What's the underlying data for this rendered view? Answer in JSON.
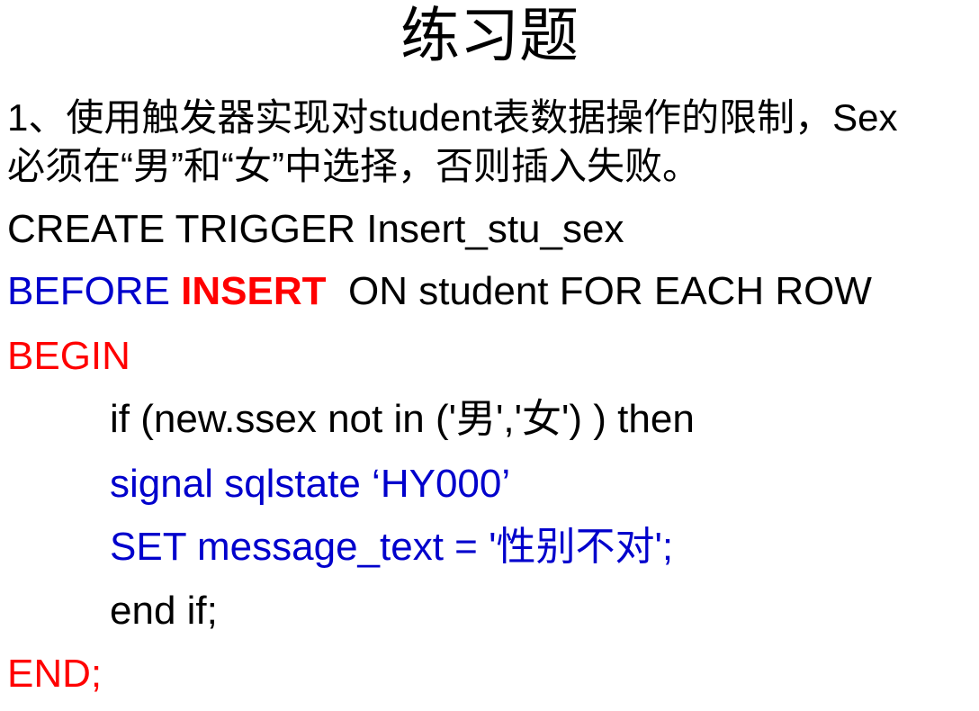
{
  "title": "练习题",
  "question": {
    "line1": "1、使用触发器实现对student表数据操作的限制，Sex",
    "line2": "必须在“男”和“女”中选择，否则插入失败。"
  },
  "code": {
    "create_line": "CREATE TRIGGER Insert_stu_sex",
    "before_insert_line": {
      "before": "BEFORE ",
      "insert": "INSERT",
      "rest": "  ON student FOR EACH ROW"
    },
    "begin": "BEGIN",
    "if_line": "if (new.ssex not in ('男','女') ) then",
    "signal_line": "signal sqlstate ‘HY000’",
    "set_line": "SET message_text = '性别不对';",
    "end_if": "end if;",
    "end": "END;"
  },
  "colors": {
    "keyword_blue": "#0000cc",
    "keyword_red": "#ff0000",
    "text": "#000000"
  }
}
